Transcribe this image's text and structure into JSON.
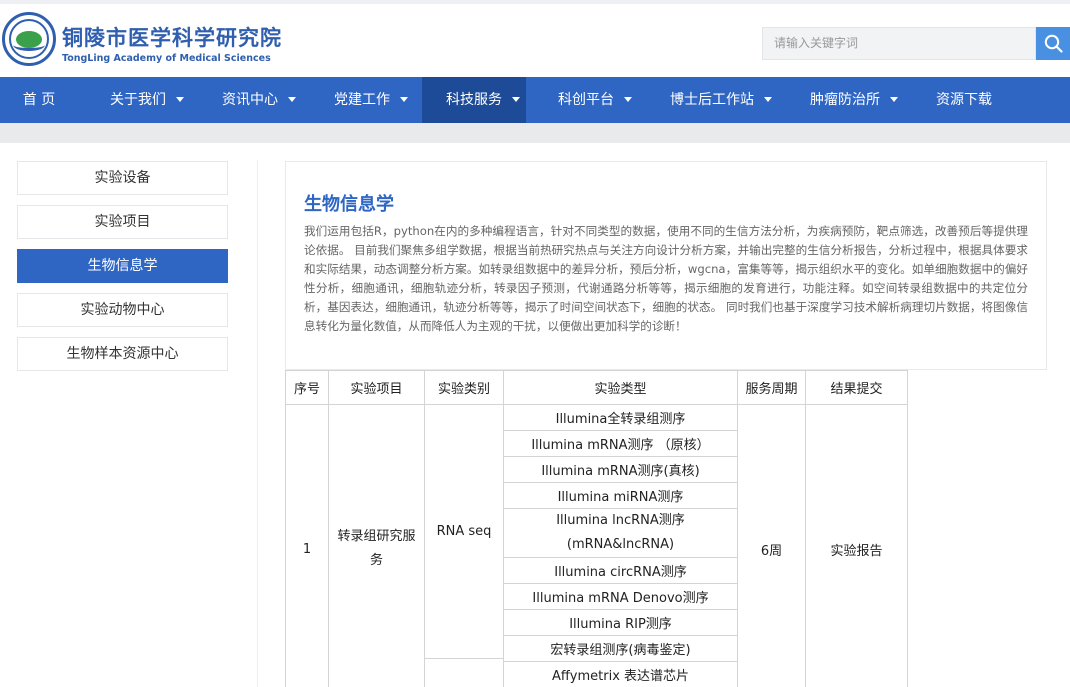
{
  "header": {
    "title": "铜陵市医学科学研究院",
    "subtitle": "TongLing Academy of Medical Sciences",
    "search_placeholder": "请输入关键字词"
  },
  "nav": {
    "items": [
      {
        "label": "首 页",
        "has_caret": false
      },
      {
        "label": "关于我们",
        "has_caret": true
      },
      {
        "label": "资讯中心",
        "has_caret": true
      },
      {
        "label": "党建工作",
        "has_caret": true
      },
      {
        "label": "科技服务",
        "has_caret": true,
        "active": true
      },
      {
        "label": "科创平台",
        "has_caret": true
      },
      {
        "label": "博士后工作站",
        "has_caret": true
      },
      {
        "label": "肿瘤防治所",
        "has_caret": true
      },
      {
        "label": "资源下载",
        "has_caret": false
      }
    ]
  },
  "sidebar": {
    "items": [
      {
        "label": "实验设备"
      },
      {
        "label": "实验项目"
      },
      {
        "label": "生物信息学",
        "active": true
      },
      {
        "label": "实验动物中心"
      },
      {
        "label": "生物样本资源中心"
      }
    ]
  },
  "main": {
    "title": "生物信息学",
    "description": "我们运用包括R，python在内的多种编程语言，针对不同类型的数据，使用不同的生信方法分析，为疾病预防，靶点筛选，改善预后等提供理论依据。 目前我们聚焦多组学数据，根据当前热研究热点与关注方向设计分析方案，并输出完整的生信分析报告，分析过程中，根据具体要求和实际结果，动态调整分析方案。如转录组数据中的差异分析，预后分析，wgcna，富集等等，揭示组织水平的变化。如单细胞数据中的偏好性分析，细胞通讯，细胞轨迹分析，转录因子预测，代谢通路分析等等，揭示细胞的发育进行，功能注释。如空间转录组数据中的共定位分析，基因表达，细胞通讯，轨迹分析等等，揭示了时间空间状态下，细胞的状态。 同时我们也基于深度学习技术解析病理切片数据，将图像信息转化为量化数值，从而降低人为主观的干扰，以便做出更加科学的诊断！"
  },
  "table": {
    "headers": [
      "序号",
      "实验项目",
      "实验类别",
      "实验类型",
      "服务周期",
      "结果提交"
    ],
    "row": {
      "index": "1",
      "project": "转录组研究服务",
      "category": "RNA seq",
      "period": "6周",
      "result": "实验报告"
    },
    "types": [
      "Illumina全转录组测序",
      "Illumina mRNA测序 （原核）",
      "Illumina mRNA测序(真核)",
      "Illumina miRNA测序",
      "Illumina lncRNA测序 (mRNA&lncRNA)",
      "Illumina circRNA测序",
      "Illumina mRNA Denovo测序",
      "Illumina RIP测序",
      "宏转录组测序(病毒鉴定)",
      "Affymetrix 表达谱芯片"
    ]
  }
}
